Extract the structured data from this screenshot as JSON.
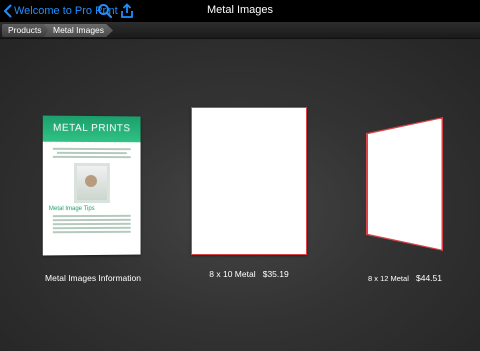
{
  "navbar": {
    "back_label": "Welcome to Pro Print",
    "title": "Metal Images",
    "icons": [
      "search-icon",
      "share-icon"
    ],
    "accent_color": "#1f8fff"
  },
  "breadcrumb": {
    "items": [
      "Products",
      "Metal Images"
    ]
  },
  "products": [
    {
      "caption": "Metal Images Information",
      "card_title": "METAL PRINTS",
      "card_subtitle": "Metal Image Tips"
    },
    {
      "name": "8 x 10 Metal",
      "price": "$35.19",
      "border_color": "#d9444a"
    },
    {
      "name": "8 x 12 Metal",
      "price": "$44.51",
      "border_color": "#d9444a"
    }
  ]
}
